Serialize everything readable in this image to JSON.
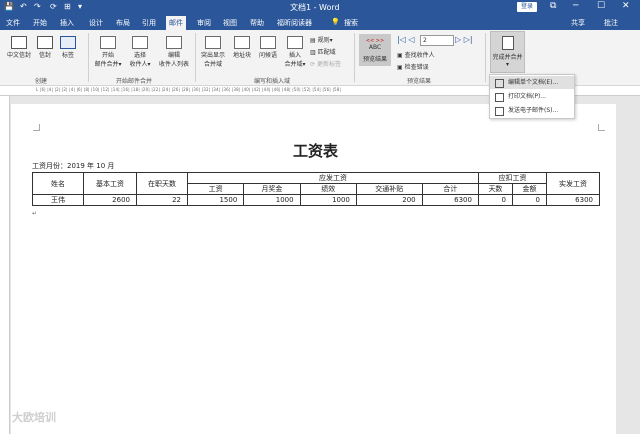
{
  "titlebar": {
    "title": "文档1 - Word",
    "login": "登录",
    "quick_access": [
      "💾",
      "↶",
      "↷",
      "⟳",
      "⊞",
      "▾"
    ],
    "window_controls": [
      "⧉",
      "─",
      "☐",
      "✕"
    ]
  },
  "tabs": {
    "items": [
      "文件",
      "开始",
      "插入",
      "设计",
      "布局",
      "引用",
      "邮件",
      "审阅",
      "视图",
      "帮助",
      "福昕阅读器"
    ],
    "search_icon": "lightbulb-icon",
    "search": "搜索",
    "share": "共享",
    "comment": "批注"
  },
  "ribbon": {
    "create": {
      "label": "创建",
      "chinese_envelope": "中文信封",
      "envelope": "信封",
      "labels": "标签"
    },
    "start_merge": {
      "label": "开始邮件合并",
      "start": [
        "开始",
        "邮件合并▾"
      ],
      "select": [
        "选择",
        "收件人▾"
      ],
      "edit": [
        "编辑",
        "收件人列表"
      ]
    },
    "write_insert": {
      "label": "编写和插入域",
      "highlight": [
        "突出显示",
        "合并域"
      ],
      "address": "地址块",
      "greeting": "问候语",
      "insert": [
        "插入",
        "合并域▾"
      ],
      "rules": "规则▾",
      "match": "匹配域",
      "update": "更新标签"
    },
    "preview": {
      "label": "预览结果",
      "abc": "ABC",
      "preview_results": "预览结果",
      "record": "2",
      "find": "查找收件人",
      "check": "检查错误"
    },
    "finish": {
      "label": [
        "完成并合并",
        "▾"
      ]
    }
  },
  "dropdown": {
    "items": [
      {
        "icon": "edit-document-icon",
        "label": "编辑单个文档(E)..."
      },
      {
        "icon": "printer-icon",
        "label": "打印文档(P)..."
      },
      {
        "icon": "email-icon",
        "label": "发送电子邮件(S)..."
      }
    ]
  },
  "ruler": {
    "text": "L |6| |4| |2| |2| |4| |6| |8| |10| |12| |14| |16| |18| |20| |22| |24| |26| |28| |30| |32| |34| |36| |38| |40| |42| |44| |46| |48| |50| |52| |54| |56| |58|"
  },
  "document": {
    "title": "工资表",
    "month_label": "工资月份：2019 年 10 月",
    "table": {
      "headers": {
        "name": "姓名",
        "base": "基本工资",
        "days": "在职天数",
        "payable": "应发工资",
        "deduct": "应扣工资",
        "actual": "实发工资"
      },
      "sub_headers": [
        "工资",
        "月奖金",
        "绩效",
        "交通补贴",
        "合计",
        "天数",
        "金额"
      ],
      "rows": [
        {
          "name": "王伟",
          "base": "2600",
          "days": "22",
          "salary": "1500",
          "bonus": "1000",
          "performance": "1000",
          "transport": "200",
          "total": "6300",
          "deduct_days": "0",
          "deduct_amount": "0",
          "actual": "6300"
        }
      ]
    }
  },
  "watermark": "大欧培训"
}
